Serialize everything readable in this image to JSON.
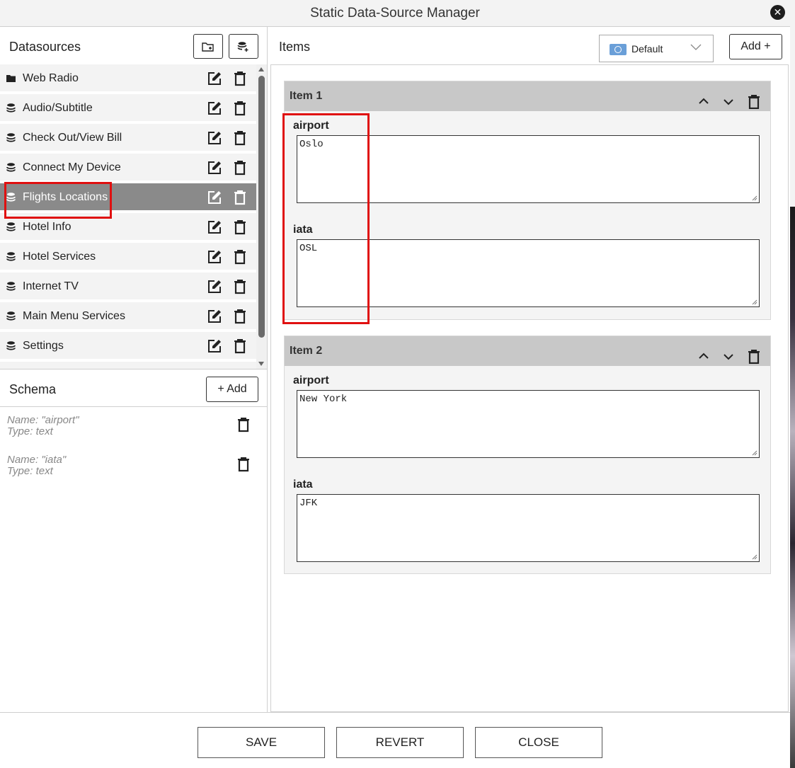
{
  "title": "Static Data-Source Manager",
  "datasources": {
    "heading": "Datasources",
    "items": [
      {
        "label": "Web Radio",
        "icon": "folder-icon"
      },
      {
        "label": "Audio/Subtitle",
        "icon": "database-icon"
      },
      {
        "label": "Check Out/View Bill",
        "icon": "database-icon"
      },
      {
        "label": "Connect My Device",
        "icon": "database-icon"
      },
      {
        "label": "Flights Locations",
        "icon": "database-icon",
        "selected": true
      },
      {
        "label": "Hotel Info",
        "icon": "database-icon"
      },
      {
        "label": "Hotel Services",
        "icon": "database-icon"
      },
      {
        "label": "Internet TV",
        "icon": "database-icon"
      },
      {
        "label": "Main Menu Services",
        "icon": "database-icon"
      },
      {
        "label": "Settings",
        "icon": "database-icon"
      }
    ]
  },
  "schema": {
    "heading": "Schema",
    "add_label": "+ Add",
    "fields": [
      {
        "name": "Name: \"airport\"",
        "type": "Type: text"
      },
      {
        "name": "Name: \"iata\"",
        "type": "Type: text"
      }
    ]
  },
  "items": {
    "heading": "Items",
    "locale": "Default",
    "add_label": "Add +",
    "cards": [
      {
        "title": "Item 1",
        "fields": [
          {
            "label": "airport",
            "value": "Oslo"
          },
          {
            "label": "iata",
            "value": "OSL"
          }
        ]
      },
      {
        "title": "Item 2",
        "fields": [
          {
            "label": "airport",
            "value": "New York"
          },
          {
            "label": "iata",
            "value": "JFK"
          }
        ]
      }
    ]
  },
  "footer": {
    "save": "SAVE",
    "revert": "REVERT",
    "close": "CLOSE"
  },
  "colors": {
    "highlight": "#e01010",
    "selected_row": "#8a8a8a"
  }
}
